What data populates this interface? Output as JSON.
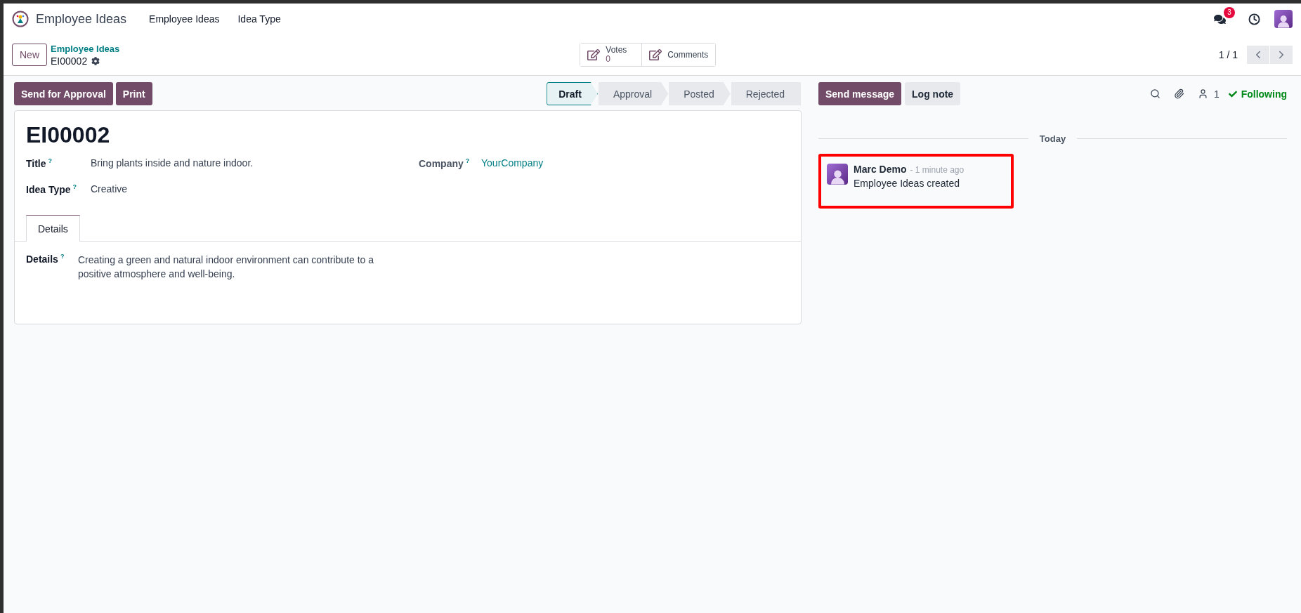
{
  "navbar": {
    "app_name": "Employee Ideas",
    "menu": [
      "Employee Ideas",
      "Idea Type"
    ],
    "messages_badge": "3"
  },
  "control_panel": {
    "new_button": "New",
    "breadcrumb": {
      "parent": "Employee Ideas",
      "current": "EI00002"
    },
    "smart_buttons": [
      {
        "label": "Votes",
        "value": "0"
      },
      {
        "label": "Comments"
      }
    ],
    "pager": "1 / 1"
  },
  "actions": [
    "Send for Approval",
    "Print"
  ],
  "stages": [
    {
      "label": "Draft",
      "selected": true
    },
    {
      "label": "Approval",
      "selected": false
    },
    {
      "label": "Posted",
      "selected": false
    },
    {
      "label": "Rejected",
      "selected": false
    }
  ],
  "form": {
    "reference": "EI00002",
    "left_fields": [
      {
        "label": "Title",
        "help": "?",
        "value": "Bring plants inside and nature indoor.",
        "kind": "text"
      },
      {
        "label": "Idea Type",
        "help": "?",
        "value": "Creative",
        "kind": "text"
      }
    ],
    "right_fields": [
      {
        "label": "Company",
        "help": "?",
        "value": "YourCompany",
        "kind": "link"
      }
    ],
    "tabs": [
      {
        "label": "Details",
        "selected": true
      }
    ],
    "details": {
      "label": "Details",
      "help": "?",
      "value": "Creating a green and natural indoor environment can contribute to a positive atmosphere and well-being."
    }
  },
  "chatter": {
    "buttons": [
      {
        "label": "Send message",
        "primary": true
      },
      {
        "label": "Log note",
        "primary": false
      }
    ],
    "followers_count": "1",
    "follow_label": "Following",
    "date_divider": "Today",
    "messages": [
      {
        "author": "Marc Demo",
        "time": "- 1 minute ago",
        "body": "Employee Ideas created",
        "highlighted": true
      }
    ]
  }
}
